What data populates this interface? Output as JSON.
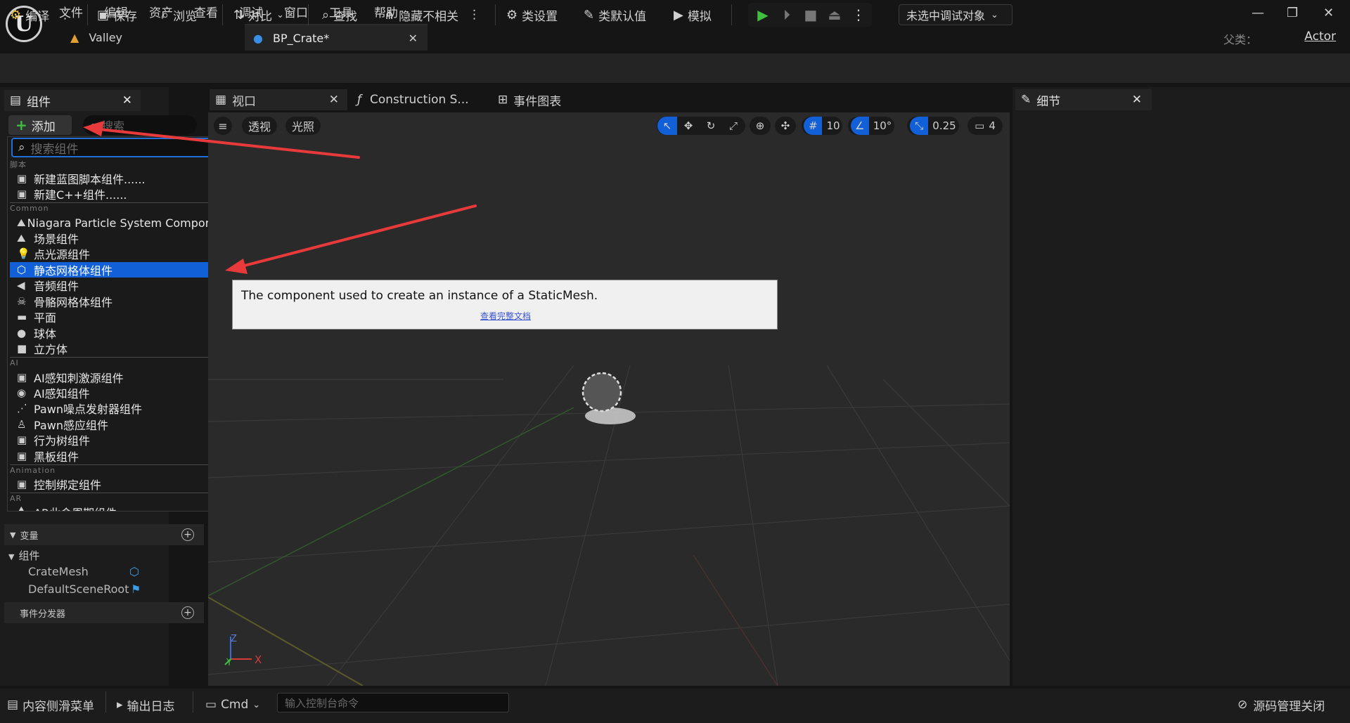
{
  "app": {
    "logo": "U"
  },
  "menu": [
    "文件",
    "编辑",
    "资产",
    "查看",
    "调试",
    "窗口",
    "工具",
    "帮助"
  ],
  "tabs": [
    {
      "label": "Valley",
      "icon": "level-icon"
    },
    {
      "label": "BP_Crate*",
      "icon": "blueprint-icon"
    }
  ],
  "parent": {
    "label": "父类：",
    "value": "Actor"
  },
  "toolbar": {
    "compile": "编译",
    "save": "保存",
    "browse": "浏览",
    "diff": "对比",
    "find": "查找",
    "hide_unrelated": "隐藏不相关",
    "class_settings": "类设置",
    "class_defaults": "类默认值",
    "simulate": "模拟",
    "debug_target": "未选中调试对象"
  },
  "components_panel": {
    "tab_label": "组件",
    "add_label": "添加",
    "search_placeholder": "搜索"
  },
  "add_popup": {
    "search_placeholder": "搜索组件",
    "categories": {
      "script": "脚本",
      "common": "Common",
      "ai": "AI",
      "animation": "Animation",
      "ar": "AR"
    },
    "script_items": [
      "新建蓝图脚本组件......",
      "新建C++组件......"
    ],
    "common_items": [
      "Niagara Particle System Component",
      "场景组件",
      "点光源组件",
      "静态网格体组件",
      "音频组件",
      "骨骼网格体组件",
      "平面",
      "球体",
      "立方体"
    ],
    "ai_items": [
      "AI感知刺激源组件",
      "AI感知组件",
      "Pawn噪点发射器组件",
      "Pawn感应组件",
      "行为树组件",
      "黑板组件"
    ],
    "animation_items": [
      "控制绑定组件"
    ],
    "ar_items": [
      "AR此命周期组件"
    ],
    "selected": "静态网格体组件"
  },
  "my_blueprint": {
    "variables": "变量",
    "components": "组件",
    "component_items": [
      "CrateMesh",
      "DefaultSceneRoot"
    ],
    "event_dispatchers": "事件分发器"
  },
  "viewport_tabs": [
    "视口",
    "Construction S...",
    "事件图表"
  ],
  "viewport": {
    "perspective": "透视",
    "lighting": "光照",
    "grid_size": "10",
    "rotation_snap": "10°",
    "scale_snap": "0.25",
    "camera_speed": "4",
    "axis_x": "X",
    "axis_y": "Y",
    "axis_z": "Z"
  },
  "tooltip": {
    "text": "The component used to create an instance of a StaticMesh.",
    "link": "查看完整文档"
  },
  "details": {
    "tab_label": "细节"
  },
  "statusbar": {
    "content_drawer": "内容侧滑菜单",
    "output_log": "输出日志",
    "cmd": "Cmd",
    "console_placeholder": "输入控制台命令",
    "source_control": "源码管理关闭"
  },
  "colors": {
    "selection": "#1160d8",
    "play": "#3ec03e",
    "arrow": "#e83a3a",
    "tooltip_bg": "#f0f0f0"
  }
}
